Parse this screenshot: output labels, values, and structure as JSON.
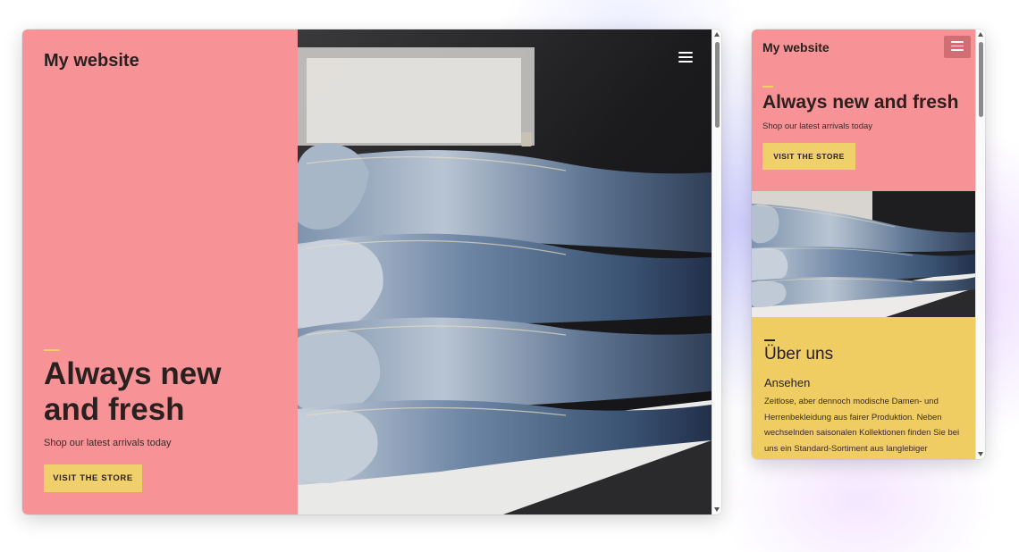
{
  "desktop": {
    "site_title": "My website",
    "menu_icon": "hamburger-menu-icon",
    "hero": {
      "headline": "Always new and fresh",
      "subtitle": "Shop our latest arrivals today",
      "cta_label": "VISIT THE STORE"
    },
    "image_subject": "stack of folded denim jeans"
  },
  "mobile": {
    "site_title": "My website",
    "menu_icon": "hamburger-menu-icon",
    "hero": {
      "headline": "Always new and fresh",
      "subtitle": "Shop our latest arrivals today",
      "cta_label": "VISIT THE STORE"
    },
    "image_subject": "stack of folded denim jeans",
    "about": {
      "heading": "Über uns",
      "subheading": "Ansehen",
      "body": "Zeitlose, aber dennoch modische Damen- und Herrenbekleidung aus fairer Produktion. Neben wechselnden saisonalen Kollektionen finden Sie bei uns ein Standard-Sortiment aus langlebiger"
    }
  },
  "colors": {
    "hero_pink": "#f79396",
    "accent_yellow": "#efd06a",
    "about_yellow": "#efcd63",
    "menu_button_mobile": "#cf6f74",
    "text_dark": "#2b2020"
  }
}
